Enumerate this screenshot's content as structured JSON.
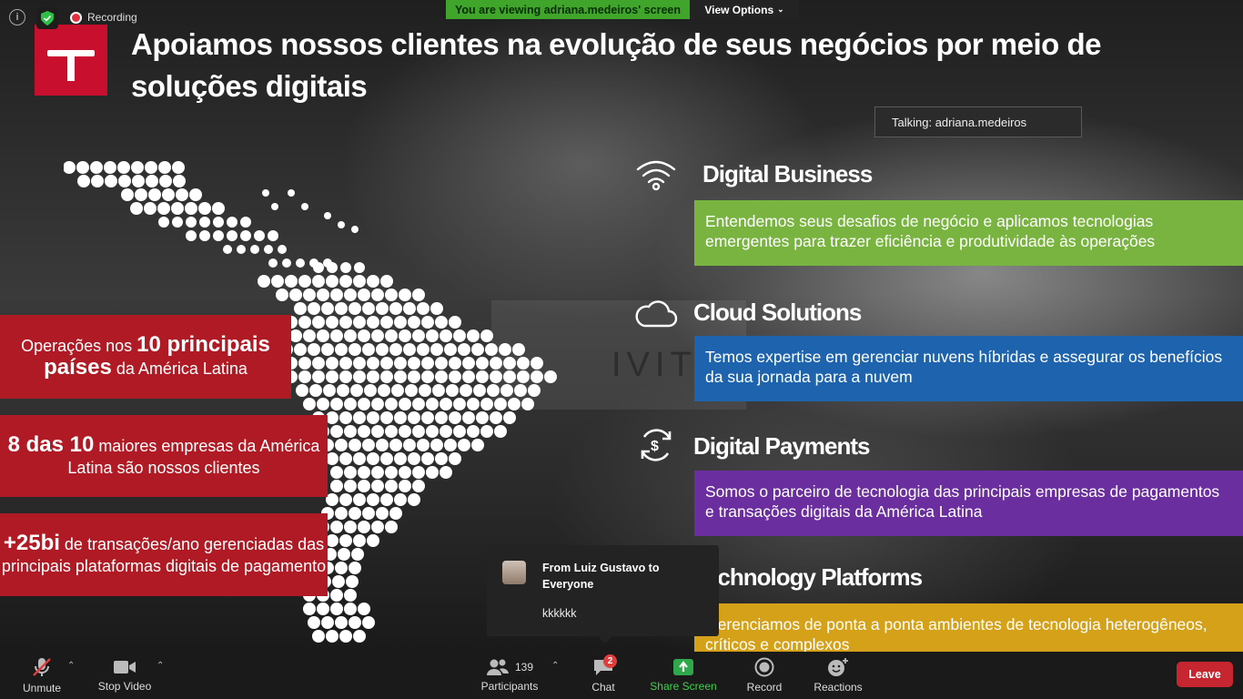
{
  "meeting": {
    "viewing_banner": "You are viewing adriana.medeiros' screen",
    "view_options": "View Options",
    "recording": "Recording",
    "talking": "Talking: adriana.medeiros"
  },
  "slide": {
    "title": "Apoiamos nossos clientes na evolução de seus negócios por meio de soluções digitais",
    "wall_text": "IVIT",
    "stats": [
      {
        "pre": "Operações nos ",
        "bold": "10 principais países",
        "post": " da América Latina"
      },
      {
        "bold": "8 das 10",
        "post": " maiores empresas da América Latina são nossos clientes"
      },
      {
        "bold": "+25bi",
        "post": " de transações/ano gerenciadas das principais plataformas digitais de pagamento"
      }
    ],
    "services": [
      {
        "title": "Digital Business",
        "text": "Entendemos seus desafios de negócio e aplicamos tecnologias emergentes para trazer eficiência e produtividade às operações",
        "icon": "wifi-icon",
        "color": "#79b340"
      },
      {
        "title": "Cloud Solutions",
        "text": "Temos expertise em gerenciar nuvens híbridas e assegurar os benefícios da sua jornada para a nuvem",
        "icon": "cloud-icon",
        "color": "#1e63ad"
      },
      {
        "title": "Digital Payments",
        "text": "Somos o parceiro de tecnologia das principais empresas de pagamentos e transações digitais da América Latina",
        "icon": "dollar-cycle-icon",
        "color": "#6a2e9e"
      },
      {
        "title": "Technology Platforms",
        "text": "Gerenciamos de ponta a ponta ambientes de tecnologia heterogêneos, críticos e complexos",
        "icon": "",
        "color": "#d4a118"
      }
    ]
  },
  "chat_popup": {
    "from": "From Luiz Gustavo to Everyone",
    "message": "kkkkkk"
  },
  "toolbar": {
    "unmute": "Unmute",
    "stop_video": "Stop Video",
    "participants": "Participants",
    "participants_count": "139",
    "chat": "Chat",
    "chat_badge": "2",
    "share_screen": "Share Screen",
    "record": "Record",
    "reactions": "Reactions",
    "leave": "Leave"
  }
}
